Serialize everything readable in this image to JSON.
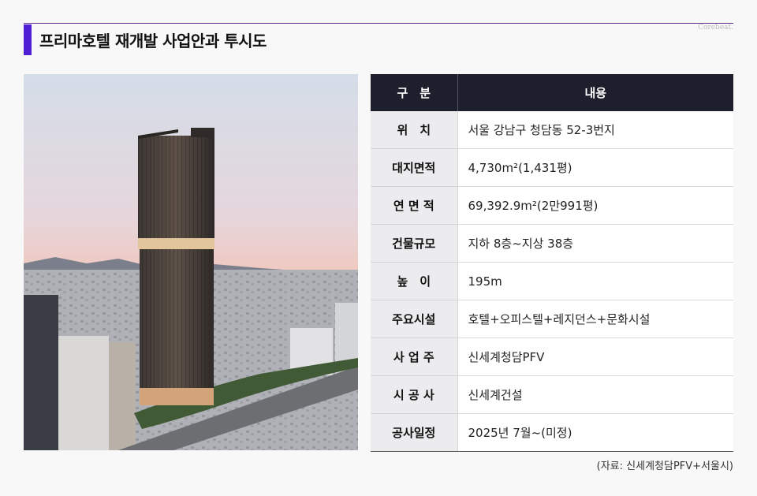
{
  "header": {
    "title": "프리마호텔 재개발 사업안과 투시도",
    "brand": "Corebeat."
  },
  "table": {
    "headers": [
      "구　분",
      "내용"
    ],
    "rows": [
      {
        "label": "위　치",
        "value": "서울 강남구 청담동 52-3번지"
      },
      {
        "label": "대지면적",
        "value": "4,730m²(1,431평)"
      },
      {
        "label": "연 면 적",
        "value": "69,392.9m²(2만991평)"
      },
      {
        "label": "건물규모",
        "value": "지하 8층~지상 38층"
      },
      {
        "label": "높　이",
        "value": "195m"
      },
      {
        "label": "주요시설",
        "value": "호텔+오피스텔+레지던스+문화시설"
      },
      {
        "label": "사 업 주",
        "value": "신세계청담PFV"
      },
      {
        "label": "시 공 사",
        "value": "신세계건설"
      },
      {
        "label": "공사일정",
        "value": "2025년 7월~(미정)"
      }
    ]
  },
  "footer": {
    "source": "(자료: 신세계청담PFV+서울시)"
  }
}
